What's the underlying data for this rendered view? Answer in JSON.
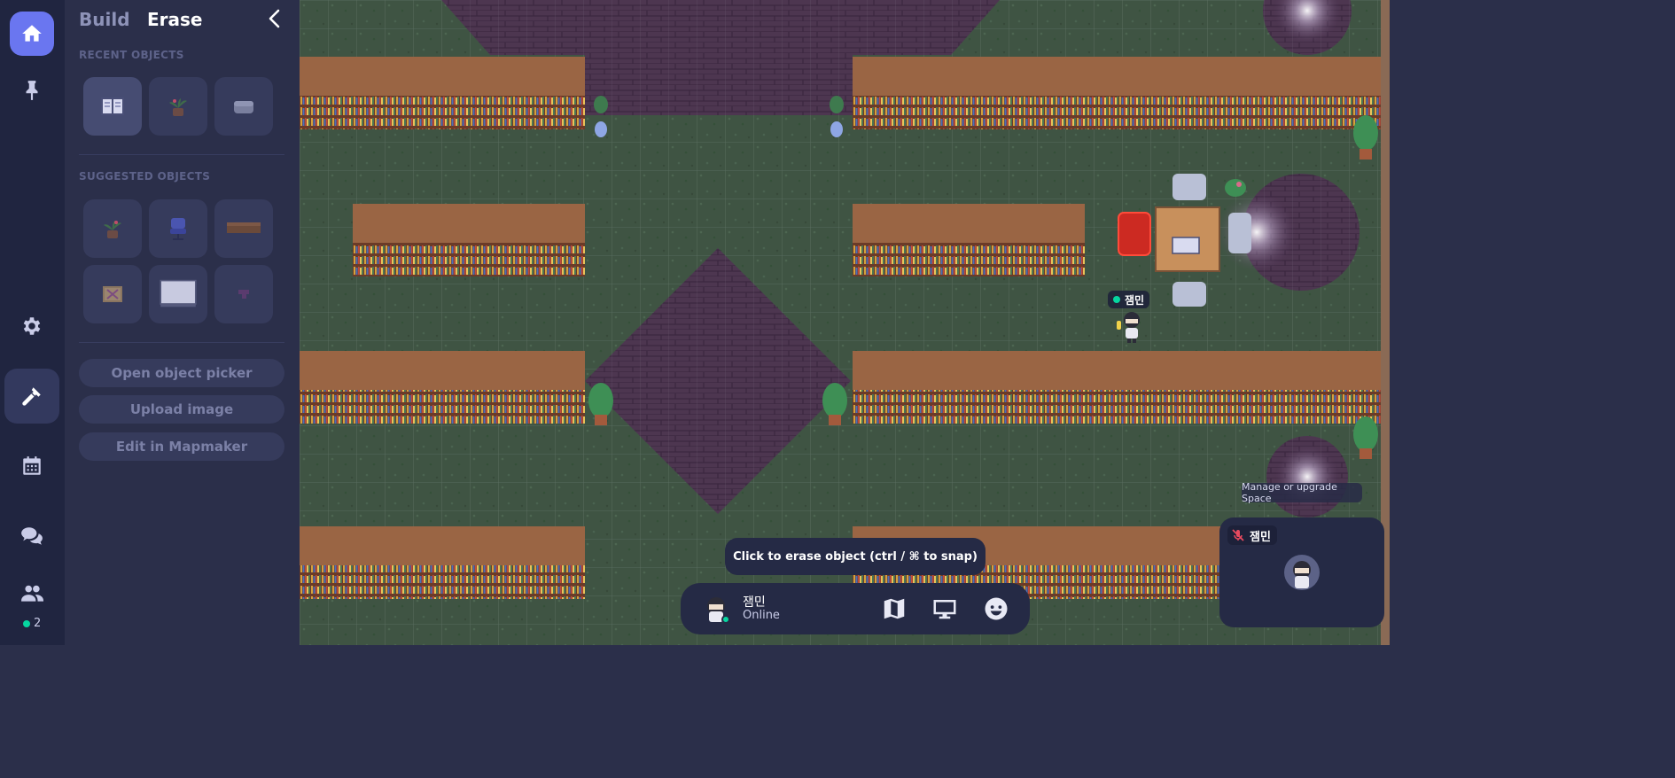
{
  "rail": {
    "items": [
      "home",
      "pin",
      "settings",
      "build",
      "calendar",
      "chat",
      "people"
    ],
    "online_count": "2",
    "accent": "#6a76f0",
    "online_color": "#06d6a0"
  },
  "panel": {
    "tabs": {
      "build": "Build",
      "erase": "Erase"
    },
    "active_tab": "Erase",
    "recent_title": "RECENT OBJECTS",
    "recent": [
      "book-object",
      "potted-plant-object",
      "grey-cushion-object"
    ],
    "suggested_title": "SUGGESTED OBJECTS",
    "suggested": [
      "potted-plant-object",
      "blue-office-chair-object",
      "wooden-desk-object",
      "patterned-rug-object",
      "whiteboard-object",
      "tetris-block-object"
    ],
    "buttons": {
      "open_picker": "Open object picker",
      "upload_image": "Upload image",
      "edit_mapmaker": "Edit in Mapmaker"
    }
  },
  "map": {
    "player": {
      "name": "잼민",
      "status": "online"
    }
  },
  "hint": "Click to erase object (ctrl / ⌘ to snap)",
  "bottom_bar": {
    "name": "잼민",
    "status": "Online",
    "icons": [
      "map-icon",
      "screen-share-icon",
      "emoji-icon"
    ]
  },
  "manage_tooltip": "Manage or upgrade Space",
  "video_tile": {
    "name": "잼민",
    "mic": "muted"
  }
}
